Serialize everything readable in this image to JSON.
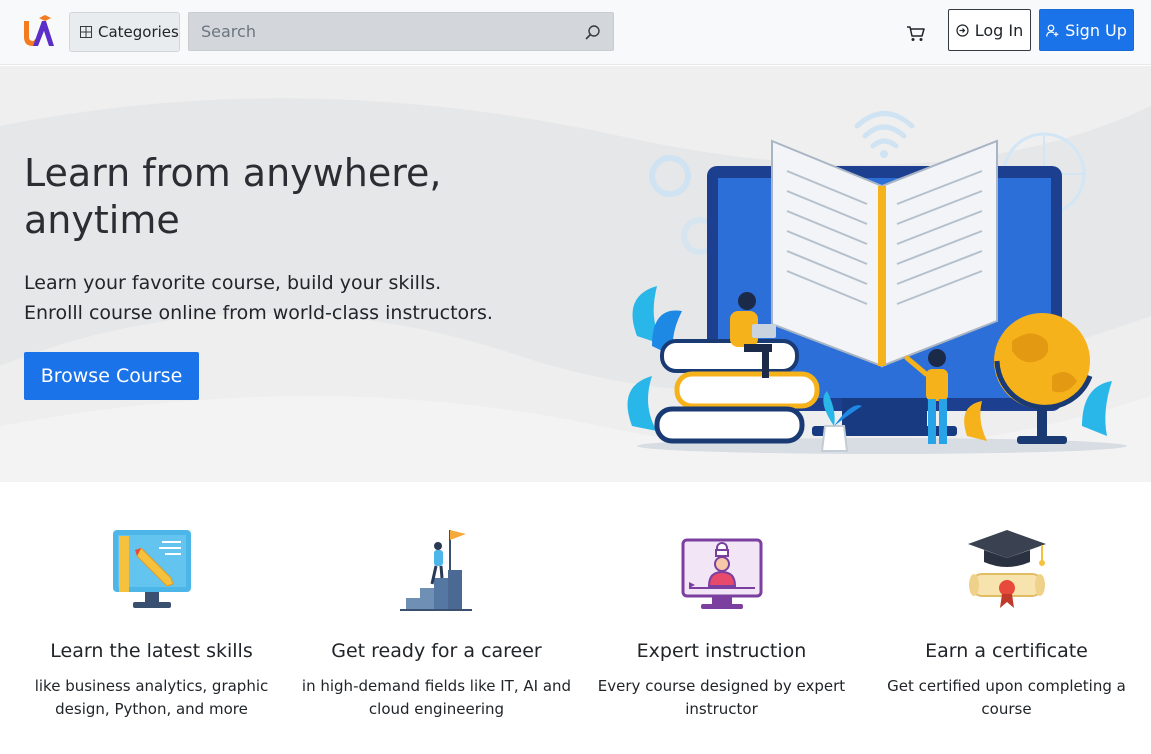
{
  "navbar": {
    "categories_label": "Categories",
    "search_placeholder": "Search",
    "search_value": "",
    "login_label": "Log In",
    "signup_label": "Sign Up",
    "icons": {
      "logo": "ua-logo",
      "categories": "grid-icon",
      "search": "search-icon",
      "cart": "cart-icon",
      "login": "login-arrow-icon",
      "signup": "person-plus-icon"
    }
  },
  "hero": {
    "title_line1": "Learn from anywhere,",
    "title_line2": "anytime",
    "subtitle_line1": "Learn your favorite course, build your skills.",
    "subtitle_line2": "Enrolll course online from world-class instructors.",
    "cta_label": "Browse Course",
    "illustration": "open-book-learning-illustration"
  },
  "features": [
    {
      "icon": "monitor-pencil-icon",
      "title": "Learn the latest skills",
      "desc_line1": "like business analytics, graphic",
      "desc_line2": "design, Python, and more"
    },
    {
      "icon": "career-steps-flag-icon",
      "title": "Get ready for a career",
      "desc_line1": "in high-demand fields like IT, AI and",
      "desc_line2": "cloud engineering"
    },
    {
      "icon": "video-instructor-icon",
      "title": "Expert instruction",
      "desc_line1": "Every course designed by expert",
      "desc_line2": "instructor"
    },
    {
      "icon": "graduation-cap-diploma-icon",
      "title": "Earn a certificate",
      "desc_line1": "Get certified upon completing a",
      "desc_line2": "course"
    }
  ],
  "colors": {
    "primary": "#1a73e8",
    "navbar_bg": "#f8f9fa",
    "hero_bg": "#e6e7e8",
    "logo_orange": "#f47c20",
    "logo_purple": "#5b2ec9"
  }
}
